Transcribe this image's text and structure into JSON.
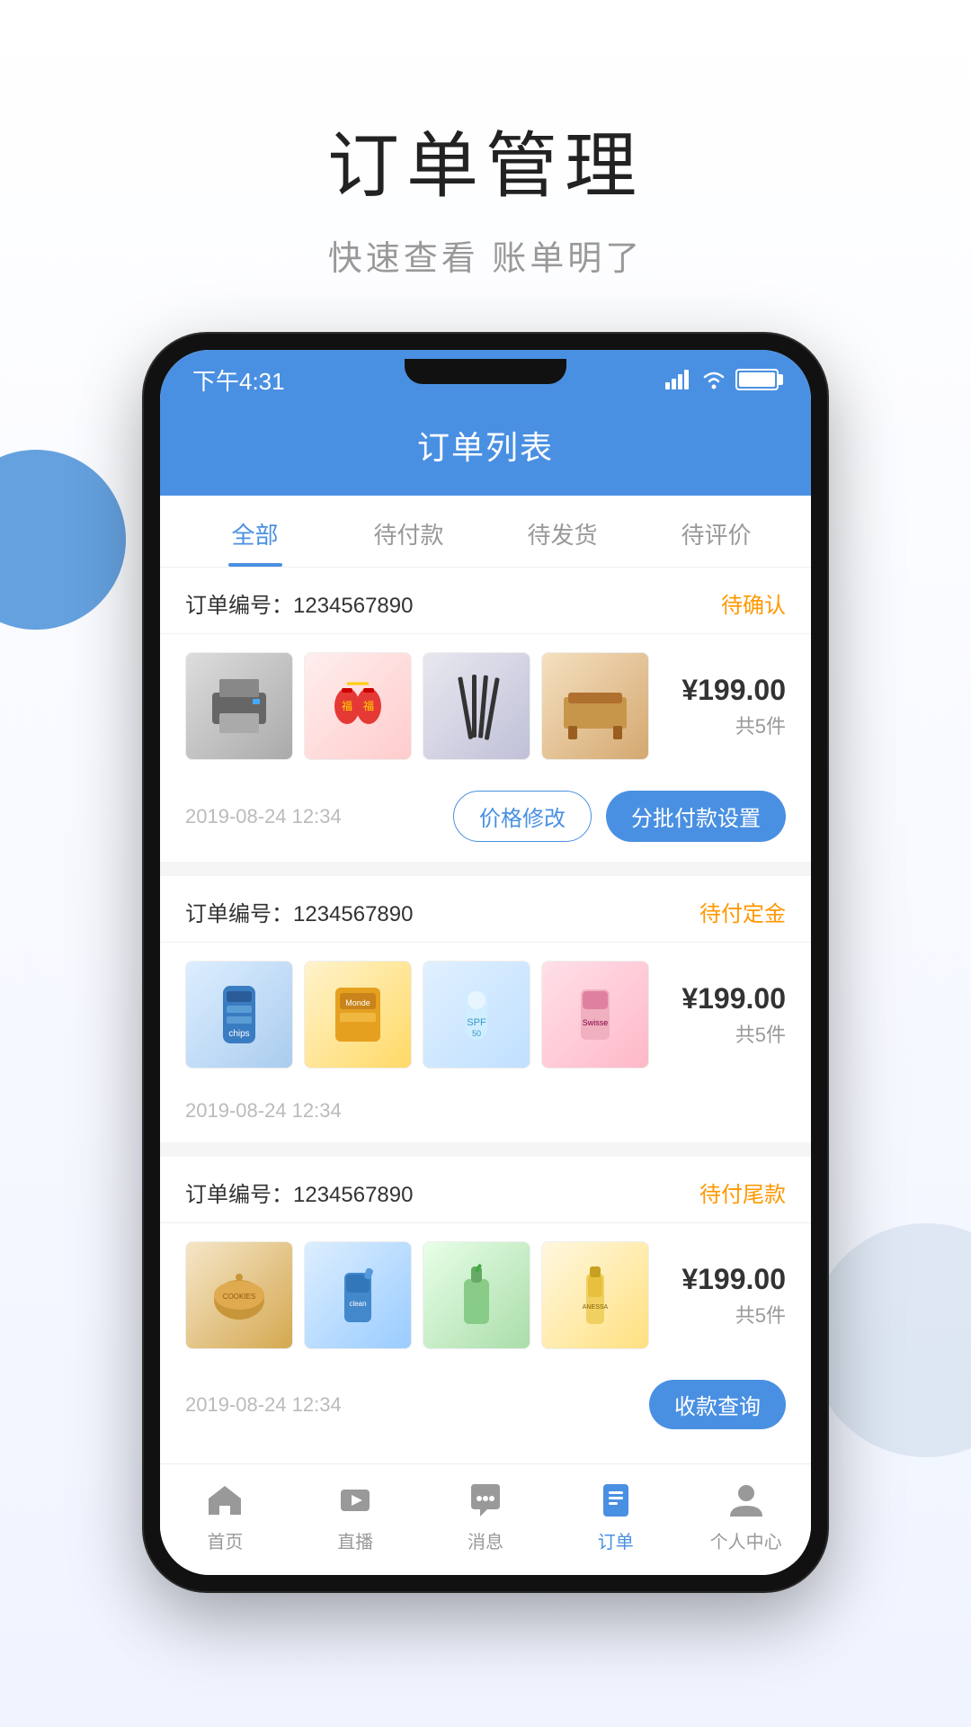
{
  "page": {
    "title": "订单管理",
    "subtitle": "快速查看 账单明了"
  },
  "phone": {
    "status_bar": {
      "time": "下午4:31"
    },
    "app_header": {
      "title": "订单列表"
    },
    "tabs": [
      {
        "label": "全部",
        "active": true
      },
      {
        "label": "待付款",
        "active": false
      },
      {
        "label": "待发货",
        "active": false
      },
      {
        "label": "待评价",
        "active": false
      }
    ],
    "orders": [
      {
        "id": "order-1",
        "number_label": "订单编号：1234567890",
        "status": "待确认",
        "status_class": "status-pending",
        "products": [
          "prod-printer",
          "prod-lantern",
          "prod-chopsticks",
          "prod-furniture"
        ],
        "price": "¥199.00",
        "count": "共5件",
        "date": "2019-08-24 12:34",
        "actions": [
          {
            "label": "价格修改",
            "type": "outline"
          },
          {
            "label": "分批付款设置",
            "type": "filled"
          }
        ]
      },
      {
        "id": "order-2",
        "number_label": "订单编号：1234567890",
        "status": "待付定金",
        "status_class": "status-deposit",
        "products": [
          "prod-chips",
          "prod-snack",
          "prod-sunscreen",
          "prod-medicine"
        ],
        "price": "¥199.00",
        "count": "共5件",
        "date": "2019-08-24 12:34",
        "actions": []
      },
      {
        "id": "order-3",
        "number_label": "订单编号：1234567890",
        "status": "待付尾款",
        "status_class": "status-tail",
        "products": [
          "prod-cookie",
          "prod-cleaner",
          "prod-lotion",
          "prod-serum"
        ],
        "price": "¥199.00",
        "count": "共5件",
        "date": "2019-08-24 12:34",
        "actions": [
          {
            "label": "收款查询",
            "type": "filled"
          }
        ]
      }
    ],
    "bottom_nav": [
      {
        "id": "nav-home",
        "label": "首页",
        "active": false,
        "icon": "home"
      },
      {
        "id": "nav-live",
        "label": "直播",
        "active": false,
        "icon": "live"
      },
      {
        "id": "nav-message",
        "label": "消息",
        "active": false,
        "icon": "message"
      },
      {
        "id": "nav-order",
        "label": "订单",
        "active": true,
        "icon": "order"
      },
      {
        "id": "nav-profile",
        "label": "个人中心",
        "active": false,
        "icon": "profile"
      }
    ]
  }
}
